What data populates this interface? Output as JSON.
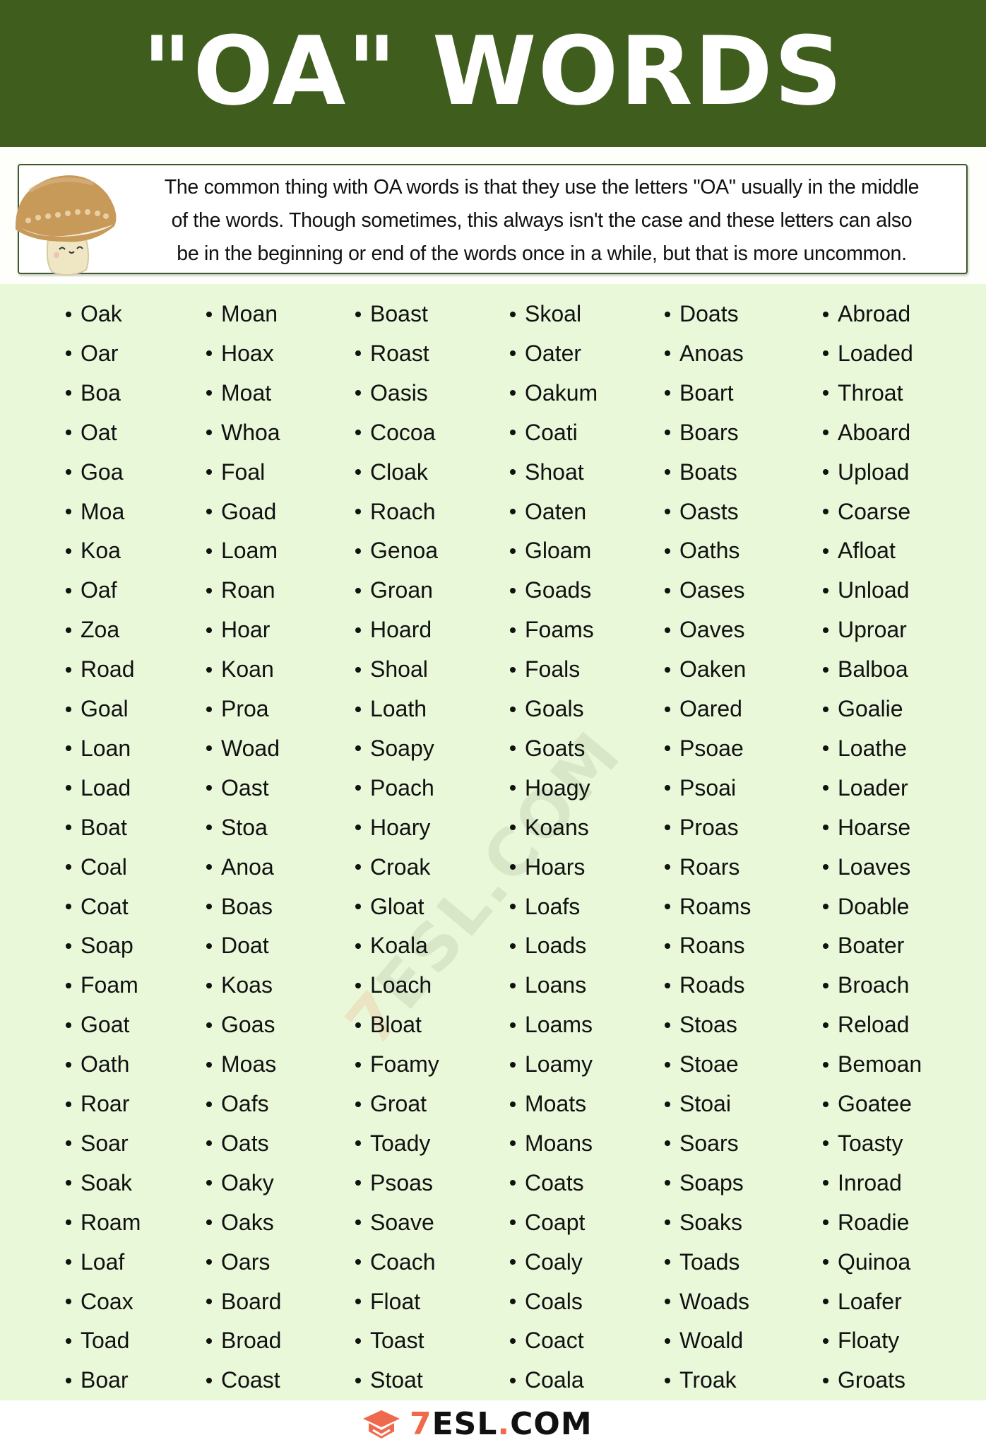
{
  "header": {
    "title": "\"OA\" WORDS",
    "background_color": "#3f5e1e"
  },
  "intro": {
    "icon": "mushroom-icon",
    "lines": [
      "The common thing with OA words is that they use the letters \"OA\" usually in the middle",
      "of the words. Though sometimes, this always isn't the case and these letters can also",
      "be in the beginning or end of the words once in a while, but that is more uncommon."
    ]
  },
  "word_list": {
    "background_color": "#eaf8da",
    "columns": [
      [
        "Oak",
        "Oar",
        "Boa",
        "Oat",
        "Goa",
        "Moa",
        "Koa",
        "Oaf",
        "Zoa",
        "Road",
        "Goal",
        "Loan",
        "Load",
        "Boat",
        "Coal",
        "Coat",
        "Soap",
        "Foam",
        "Goat",
        "Oath",
        "Roar",
        "Soar",
        "Soak",
        "Roam",
        "Loaf",
        "Coax",
        "Toad",
        "Boar"
      ],
      [
        "Moan",
        "Hoax",
        "Moat",
        "Whoa",
        "Foal",
        "Goad",
        "Loam",
        "Roan",
        "Hoar",
        "Koan",
        "Proa",
        "Woad",
        "Oast",
        "Stoa",
        "Anoa",
        "Boas",
        "Doat",
        "Koas",
        "Goas",
        "Moas",
        "Oafs",
        "Oats",
        "Oaky",
        "Oaks",
        "Oars",
        "Board",
        "Broad",
        "Coast"
      ],
      [
        "Boast",
        "Roast",
        "Oasis",
        "Cocoa",
        "Cloak",
        "Roach",
        "Genoa",
        "Groan",
        "Hoard",
        "Shoal",
        "Loath",
        "Soapy",
        "Poach",
        "Hoary",
        "Croak",
        "Gloat",
        "Koala",
        "Loach",
        "Bloat",
        "Foamy",
        "Groat",
        "Toady",
        "Psoas",
        "Soave",
        "Coach",
        "Float",
        "Toast",
        "Stoat"
      ],
      [
        "Skoal",
        "Oater",
        "Oakum",
        "Coati",
        "Shoat",
        "Oaten",
        "Gloam",
        "Goads",
        "Foams",
        "Foals",
        "Goals",
        "Goats",
        "Hoagy",
        "Koans",
        "Hoars",
        "Loafs",
        "Loads",
        "Loans",
        "Loams",
        "Loamy",
        "Moats",
        "Moans",
        "Coats",
        "Coapt",
        "Coaly",
        "Coals",
        "Coact",
        "Coala"
      ],
      [
        "Doats",
        "Anoas",
        "Boart",
        "Boars",
        "Boats",
        "Oasts",
        "Oaths",
        "Oases",
        "Oaves",
        "Oaken",
        "Oared",
        "Psoae",
        "Psoai",
        "Proas",
        "Roars",
        "Roams",
        "Roans",
        "Roads",
        "Stoas",
        "Stoae",
        "Stoai",
        "Soars",
        "Soaps",
        "Soaks",
        "Toads",
        "Woads",
        "Woald",
        "Troak"
      ],
      [
        "Abroad",
        "Loaded",
        "Throat",
        "Aboard",
        "Upload",
        "Coarse",
        "Afloat",
        "Unload",
        "Uproar",
        "Balboa",
        "Goalie",
        "Loathe",
        "Loader",
        "Hoarse",
        "Loaves",
        "Doable",
        "Boater",
        "Broach",
        "Reload",
        "Bemoan",
        "Goatee",
        "Toasty",
        "Inroad",
        "Roadie",
        "Quinoa",
        "Loafer",
        "Floaty",
        "Groats"
      ]
    ]
  },
  "watermark": {
    "prefix": "7",
    "text": "ESL.COM"
  },
  "footer": {
    "logo_prefix": "7",
    "logo_main": "ESL",
    "logo_dot": ".",
    "logo_suffix": "COM",
    "accent_color": "#ef6a4c"
  }
}
